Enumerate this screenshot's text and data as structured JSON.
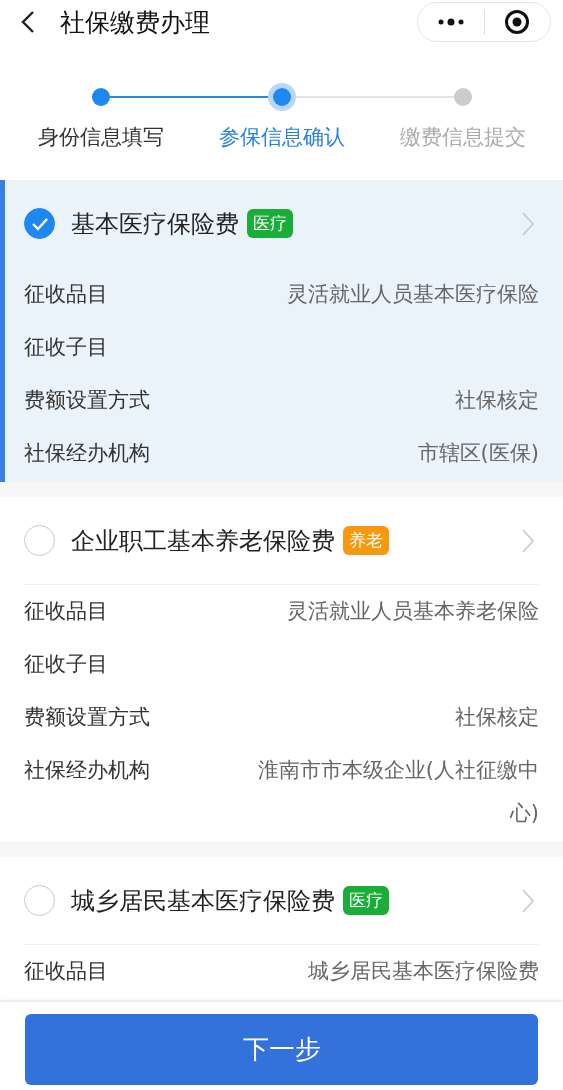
{
  "header": {
    "title": "社保缴费办理"
  },
  "steps": [
    {
      "label": "身份信息填写",
      "done": true,
      "selected": false
    },
    {
      "label": "参保信息确认",
      "done": true,
      "selected": true
    },
    {
      "label": "缴费信息提交",
      "done": false,
      "selected": false
    }
  ],
  "insurances": [
    {
      "name": "基本医疗保险费",
      "tag": "医疗",
      "color": "#1aad3a",
      "checked": true,
      "rows": [
        {
          "label": "征收品目",
          "value": "灵活就业人员基本医疗保险"
        },
        {
          "label": "征收子目"
        },
        {
          "label": "费额设置方式",
          "value": "社保核定"
        },
        {
          "label": "社保经办机构",
          "value": "市辖区(医保)"
        }
      ]
    },
    {
      "name": "企业职工基本养老保险费",
      "tag": "养老",
      "color": "#f7980f",
      "checked": false,
      "rows": [
        {
          "label": "征收品目",
          "value": "灵活就业人员基本养老保险"
        },
        {
          "label": "征收子目"
        },
        {
          "label": "费额设置方式",
          "value": "社保核定"
        },
        {
          "label": "社保经办机构",
          "value": "淮南市市本级企业(人社征缴中心)"
        }
      ]
    },
    {
      "name": "城乡居民基本医疗保险费",
      "tag": "医疗",
      "color": "#1aad3a",
      "checked": false,
      "rows": [
        {
          "label": "征收品目",
          "value": "城乡居民基本医疗保险费"
        }
      ]
    }
  ],
  "next_button": "下一步"
}
